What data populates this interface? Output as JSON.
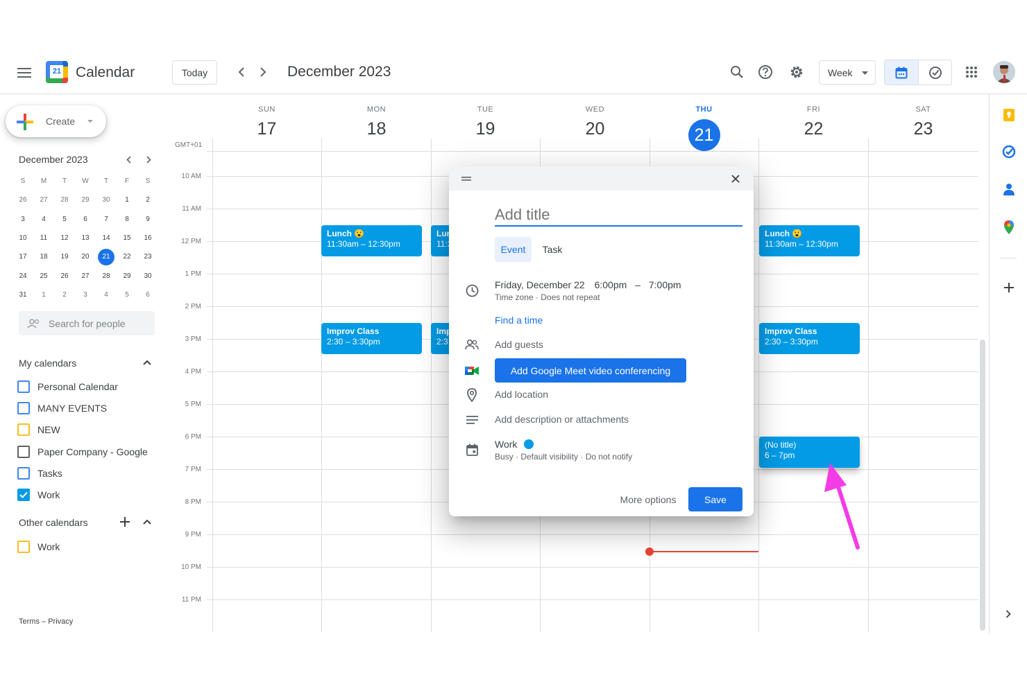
{
  "header": {
    "app_title": "Calendar",
    "logo_day": "21",
    "today_label": "Today",
    "date_range": "December 2023",
    "view_label": "Week"
  },
  "create": {
    "label": "Create"
  },
  "mini_calendar": {
    "title": "December 2023",
    "weekdays": [
      "S",
      "M",
      "T",
      "W",
      "T",
      "F",
      "S"
    ],
    "weeks": [
      [
        "26",
        "27",
        "28",
        "29",
        "30",
        "1",
        "2"
      ],
      [
        "3",
        "4",
        "5",
        "6",
        "7",
        "8",
        "9"
      ],
      [
        "10",
        "11",
        "12",
        "13",
        "14",
        "15",
        "16"
      ],
      [
        "17",
        "18",
        "19",
        "20",
        "21",
        "22",
        "23"
      ],
      [
        "24",
        "25",
        "26",
        "27",
        "28",
        "29",
        "30"
      ],
      [
        "31",
        "1",
        "2",
        "3",
        "4",
        "5",
        "6"
      ]
    ],
    "today": "21"
  },
  "people_search": {
    "placeholder": "Search for people"
  },
  "my_calendars": {
    "title": "My calendars",
    "items": [
      {
        "label": "Personal Calendar",
        "color": "#4285f4",
        "checked": false
      },
      {
        "label": "MANY EVENTS",
        "color": "#4285f4",
        "checked": false
      },
      {
        "label": "NEW",
        "color": "#f6bf26",
        "checked": false
      },
      {
        "label": "Paper Company - Google",
        "color": "#616161",
        "checked": false
      },
      {
        "label": "Tasks",
        "color": "#4285f4",
        "checked": false
      },
      {
        "label": "Work",
        "color": "#039be5",
        "checked": true
      }
    ]
  },
  "other_calendars": {
    "title": "Other calendars",
    "items": [
      {
        "label": "Work",
        "color": "#f6bf26",
        "checked": false
      }
    ]
  },
  "footer": {
    "terms": "Terms",
    "sep": " – ",
    "privacy": "Privacy"
  },
  "week": {
    "timezone": "GMT+01",
    "days": [
      {
        "name": "SUN",
        "num": "17"
      },
      {
        "name": "MON",
        "num": "18"
      },
      {
        "name": "TUE",
        "num": "19"
      },
      {
        "name": "WED",
        "num": "20"
      },
      {
        "name": "THU",
        "num": "21",
        "today": true
      },
      {
        "name": "FRI",
        "num": "22"
      },
      {
        "name": "SAT",
        "num": "23"
      }
    ],
    "hours": [
      "10 AM",
      "11 AM",
      "12 PM",
      "1 PM",
      "2 PM",
      "3 PM",
      "4 PM",
      "5 PM",
      "6 PM",
      "7 PM",
      "8 PM",
      "9 PM",
      "10 PM",
      "11 PM"
    ]
  },
  "events": {
    "lunch_mon": {
      "title": "Lunch 😮",
      "time": "11:30am – 12:30pm"
    },
    "lunch_tue": {
      "title": "Lun",
      "time": "11:3"
    },
    "lunch_fri": {
      "title": "Lunch 😮",
      "time": "11:30am – 12:30pm"
    },
    "improv_mon": {
      "title": "Improv Class",
      "time": "2:30 – 3:30pm"
    },
    "improv_tue": {
      "title": "Imp",
      "time": "2:3"
    },
    "improv_fri": {
      "title": "Improv Class",
      "time": "2:30 – 3:30pm"
    },
    "notitle_fri": {
      "title": "(No title)",
      "time": "6 – 7pm"
    },
    "color": "#039be5"
  },
  "dialog": {
    "title_placeholder": "Add title",
    "tab_event": "Event",
    "tab_task": "Task",
    "date": "Friday, December 22",
    "start": "6:00pm",
    "dash": "–",
    "end": "7:00pm",
    "tz_repeat": "Time zone · Does not repeat",
    "find_time": "Find a time",
    "add_guests": "Add guests",
    "meet_label": "Add Google Meet video conferencing",
    "add_location": "Add location",
    "add_description": "Add description or attachments",
    "calendar_name": "Work",
    "calendar_details": "Busy · Default visibility · Do not notify",
    "more_options": "More options",
    "save": "Save"
  },
  "colors": {
    "accent": "#1a73e8",
    "event": "#039be5",
    "now_line": "#ea4335",
    "annotation_arrow": "#f33ce6"
  }
}
